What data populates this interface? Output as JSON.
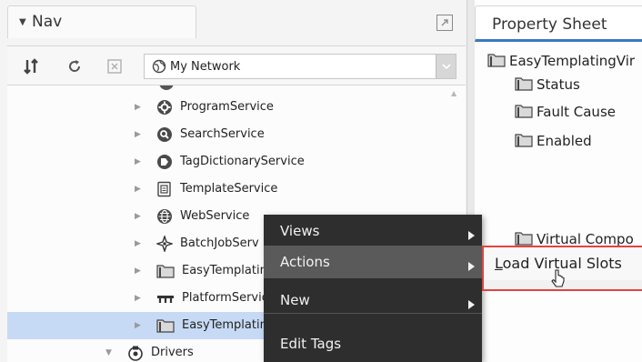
{
  "nav": {
    "title": "Nav",
    "network_select": {
      "value": "My Network"
    },
    "tree": [
      {
        "label": "ProgramService",
        "icon": "gear-circle-icon"
      },
      {
        "label": "SearchService",
        "icon": "magnifier-circle-icon"
      },
      {
        "label": "TagDictionaryService",
        "icon": "tag-circle-icon"
      },
      {
        "label": "TemplateService",
        "icon": "template-icon"
      },
      {
        "label": "WebService",
        "icon": "globe-icon"
      },
      {
        "label": "BatchJobServ",
        "icon": "compass-icon"
      },
      {
        "label": "EasyTemplatin",
        "icon": "folder-icon"
      },
      {
        "label": "PlatformServic",
        "icon": "platform-icon"
      },
      {
        "label": "EasyTemplatin",
        "icon": "folder-icon",
        "selected": true
      },
      {
        "label": "Drivers",
        "icon": "drivers-icon",
        "expanded": true
      }
    ]
  },
  "property_sheet": {
    "title": "Property Sheet",
    "rows": [
      {
        "label": "EasyTemplatingVir"
      },
      {
        "label": "Status"
      },
      {
        "label": "Fault Cause"
      },
      {
        "label": "Enabled"
      },
      {
        "label": "Virtual Compo"
      }
    ]
  },
  "context_menu": {
    "items": [
      {
        "label": "Views",
        "has_submenu": true
      },
      {
        "label": "Actions",
        "has_submenu": true,
        "active": true
      },
      {
        "label": "New",
        "has_submenu": true
      },
      {
        "label": "Edit Tags",
        "has_submenu": false
      }
    ]
  },
  "submenu": {
    "items": [
      {
        "label": "Load Virtual Slots"
      }
    ]
  },
  "colors": {
    "selection": "#c7daf5",
    "menu_bg": "#2e2e2e",
    "menu_active": "#5a5a5a",
    "highlight_border": "#e2433f",
    "tab_accent": "#3a78c4"
  }
}
